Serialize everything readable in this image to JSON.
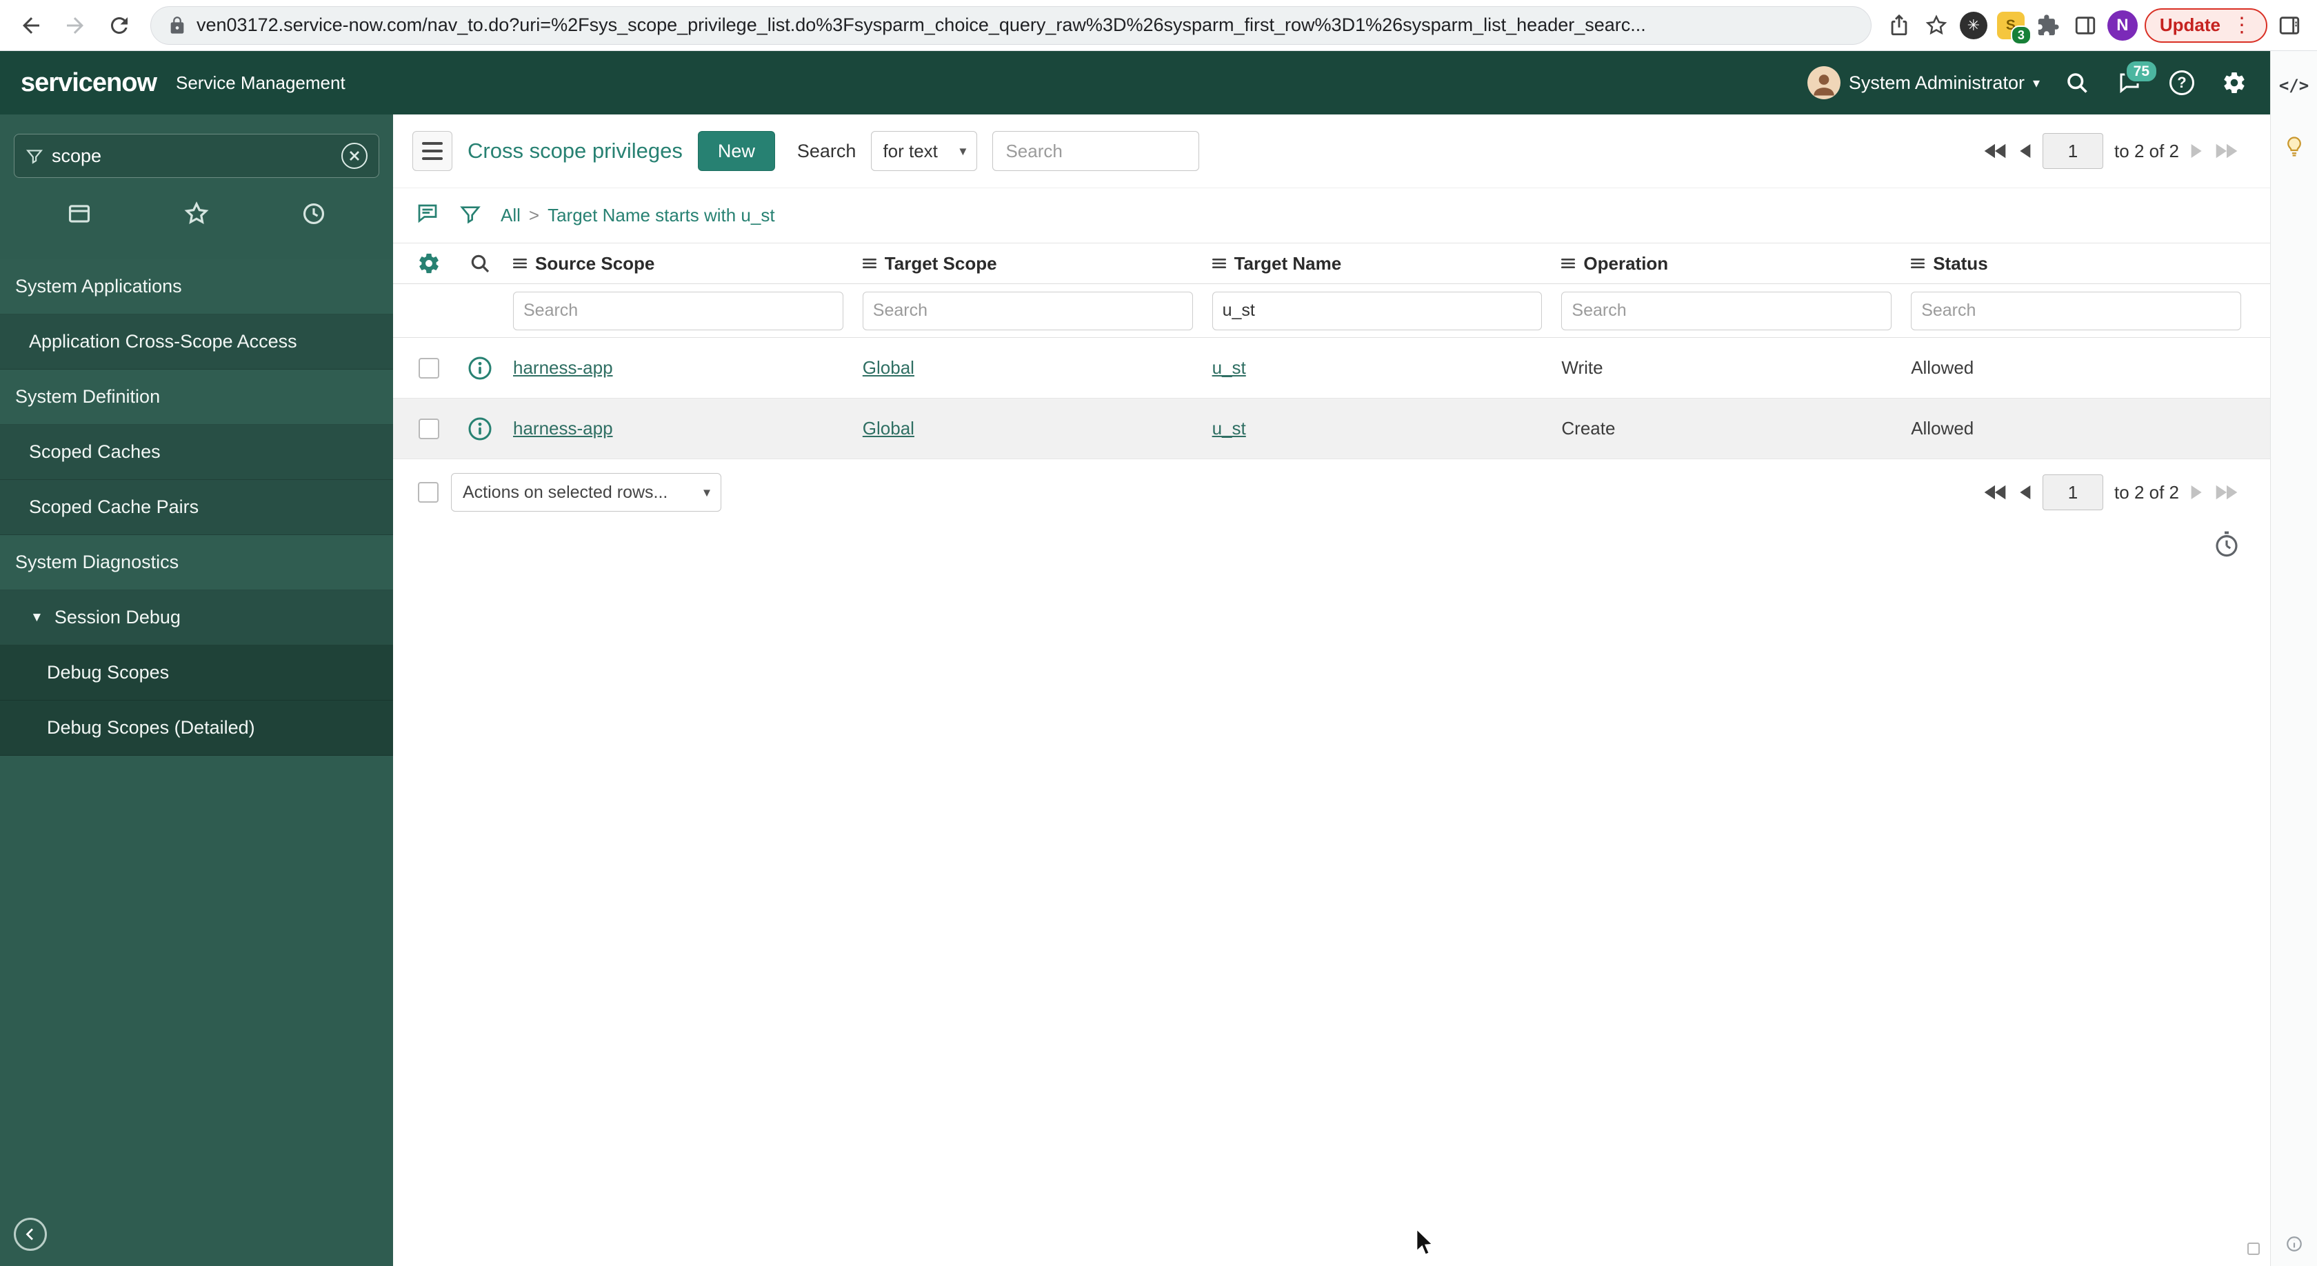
{
  "accent": "#278172",
  "browser": {
    "url": "ven03172.service-now.com/nav_to.do?uri=%2Fsys_scope_privilege_list.do%3Fsysparm_choice_query_raw%3D%26sysparm_first_row%3D1%26sysparm_list_header_searc...",
    "update_button": "Update",
    "extension_badge": "3",
    "avatar_initial": "N"
  },
  "sn_header": {
    "logo": "servicenow",
    "product": "Service Management",
    "user_name": "System Administrator",
    "notification_count": "75"
  },
  "sidebar": {
    "filter_value": "scope",
    "items": [
      {
        "label": "System Applications",
        "type": "section"
      },
      {
        "label": "Application Cross-Scope Access",
        "type": "item"
      },
      {
        "label": "System Definition",
        "type": "section"
      },
      {
        "label": "Scoped Caches",
        "type": "item"
      },
      {
        "label": "Scoped Cache Pairs",
        "type": "item"
      },
      {
        "label": "System Diagnostics",
        "type": "section"
      },
      {
        "label": "Session Debug",
        "type": "group"
      },
      {
        "label": "Debug Scopes",
        "type": "subitem"
      },
      {
        "label": "Debug Scopes (Detailed)",
        "type": "subitem"
      }
    ]
  },
  "toolbar": {
    "title": "Cross scope privileges",
    "new_button": "New",
    "search_label": "Search",
    "search_type": "for text",
    "search_placeholder": "Search"
  },
  "pagination": {
    "page": "1",
    "range_label": "to 2 of 2"
  },
  "breadcrumb": {
    "all": "All",
    "separator": ">",
    "condition": "Target Name starts with u_st"
  },
  "list": {
    "columns": [
      "Source Scope",
      "Target Scope",
      "Target Name",
      "Operation",
      "Status"
    ],
    "filter_placeholder": "Search",
    "filters": {
      "target_name": "u_st"
    },
    "rows": [
      {
        "source_scope": "harness-app",
        "target_scope": "Global",
        "target_name": "u_st",
        "operation": "Write",
        "status": "Allowed"
      },
      {
        "source_scope": "harness-app",
        "target_scope": "Global",
        "target_name": "u_st",
        "operation": "Create",
        "status": "Allowed"
      }
    ],
    "actions_label": "Actions on selected rows..."
  },
  "rail": {
    "code_label": "</>"
  }
}
